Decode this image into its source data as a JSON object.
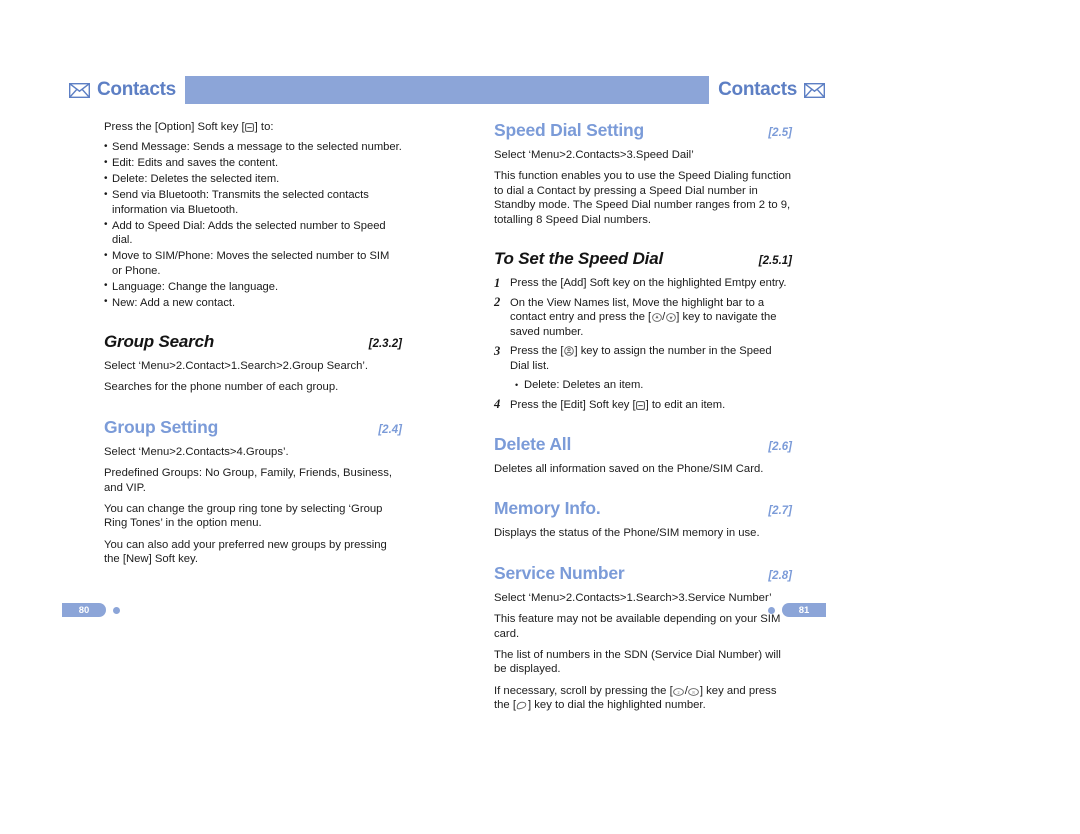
{
  "document": {
    "header": {
      "left_tab_title": "Contacts",
      "right_tab_title": "Contacts",
      "left_icon": "envelope-icon",
      "right_icon": "envelope-icon",
      "bar_color": "#8ca5d8",
      "tab_shade_color": "#aabce4",
      "title_color": "#5d7fc4"
    },
    "footer": {
      "left_page": "80",
      "right_page": "81",
      "accent_color": "#8ca5d8"
    },
    "accent_heading_color": "#7b9bd8"
  },
  "left_column": {
    "intro": {
      "before_key": "Press the [Option] Soft key [",
      "key_icon": "softkey-icon",
      "after_key": "] to:"
    },
    "option_bullets": [
      "Send Message: Sends a message to the selected number.",
      "Edit: Edits and saves the content.",
      "Delete: Deletes the selected item.",
      "Send via Bluetooth: Transmits the selected contacts information via Bluetooth.",
      "Add to Speed Dial: Adds the selected number to Speed dial.",
      "Move to SIM/Phone: Moves the selected number to SIM or Phone.",
      "Language: Change the language.",
      "New: Add a new contact."
    ],
    "group_search": {
      "title": "Group Search",
      "ref": "[2.3.2]",
      "paragraphs": [
        "Select ‘Menu>2.Contact>1.Search>2.Group Search’.",
        "Searches for the phone number of each group."
      ]
    },
    "group_setting": {
      "title": "Group Setting",
      "ref": "[2.4]",
      "paragraphs": [
        "Select ‘Menu>2.Contacts>4.Groups’.",
        "Predefined Groups: No Group, Family, Friends, Business, and VIP.",
        "You can change the group ring tone by selecting ‘Group Ring Tones’ in the option menu.",
        "You can also add your preferred new groups by pressing the [New] Soft key."
      ]
    }
  },
  "right_column": {
    "speed_dial_setting": {
      "title": "Speed Dial Setting",
      "ref": "[2.5]",
      "paragraphs": [
        "Select ‘Menu>2.Contacts>3.Speed Dail’",
        "This function enables you to use the Speed Dialing function to dial a Contact by pressing a Speed Dial number in Standby mode. The Speed Dial number ranges from 2 to 9, totalling 8 Speed Dial numbers."
      ]
    },
    "to_set_speed_dial": {
      "title": "To Set the Speed Dial",
      "ref": "[2.5.1]",
      "steps": [
        {
          "num": "1",
          "text": "Press the [Add] Soft key on the highlighted Emtpy entry."
        },
        {
          "num": "2",
          "text_before": "On the View Names list, Move the highlight bar to a contact entry and press the [",
          "key_icons": [
            "nav-up-key-icon",
            "nav-down-key-icon"
          ],
          "text_after": "] key to navigate the saved number."
        },
        {
          "num": "3",
          "text_before": "Press the [",
          "key_icons": [
            "ok-key-icon"
          ],
          "text_after": "] key to assign the number in the Speed Dial list."
        },
        {
          "num": "4",
          "text_before": "Press the [Edit] Soft key [",
          "key_icons": [
            "softkey-icon"
          ],
          "text_after": "] to edit an item."
        }
      ],
      "sub_bullet": "Delete: Deletes an item."
    },
    "delete_all": {
      "title": "Delete All",
      "ref": "[2.6]",
      "paragraphs": [
        "Deletes all information saved on the Phone/SIM Card."
      ]
    },
    "memory_info": {
      "title": "Memory Info.",
      "ref": "[2.7]",
      "paragraphs": [
        "Displays the status of the Phone/SIM memory in use."
      ]
    },
    "service_number": {
      "title": "Service Number",
      "ref": "[2.8]",
      "paragraphs": [
        "Select ‘Menu>2.Contacts>1.Search>3.Service Number’",
        "This feature may not be available depending on your SIM card.",
        "The list of numbers in the SDN (Service Dial Number) will be displayed."
      ],
      "scroll_line": {
        "before": "If necessary, scroll by pressing the [",
        "keys_1": [
          "scroll-up-key-icon",
          "scroll-down-key-icon"
        ],
        "middle": "] key and press the [",
        "keys_2": [
          "send-key-icon"
        ],
        "after": "] key to dial the highlighted number."
      }
    }
  }
}
